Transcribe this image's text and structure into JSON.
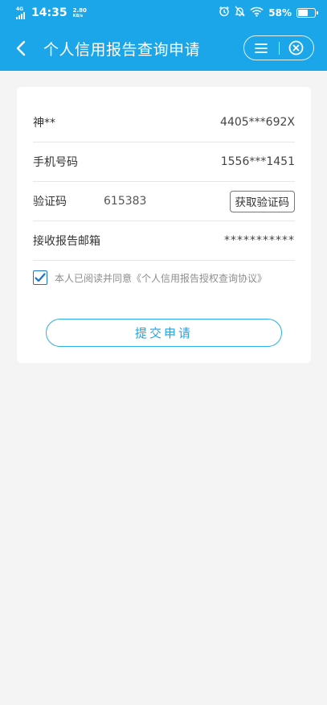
{
  "status_bar": {
    "network": "4G",
    "time": "14:35",
    "speed": "2.80",
    "speed_unit": "KB/s",
    "battery": "58%",
    "battery_level": 0.58
  },
  "navbar": {
    "title": "个人信用报告查询申请",
    "back_icon": "chevron-left-icon",
    "menu_icon": "menu-icon",
    "close_icon": "close-circle-icon"
  },
  "form": {
    "name_label": "神**",
    "id_number": "4405***692X",
    "phone_label": "手机号码",
    "phone_value": "1556***1451",
    "code_label": "验证码",
    "code_value": "615383",
    "get_code_button": "获取验证码",
    "email_label": "接收报告邮箱",
    "email_value": "***********",
    "agree_checked": true,
    "agree_text": "本人已阅读并同意《个人信用报告授权查询协议》",
    "submit_button": "提交申请"
  },
  "colors": {
    "header": "#1aa6e8",
    "page_bg": "#f4f4f4",
    "accent": "#2ab0e6"
  }
}
